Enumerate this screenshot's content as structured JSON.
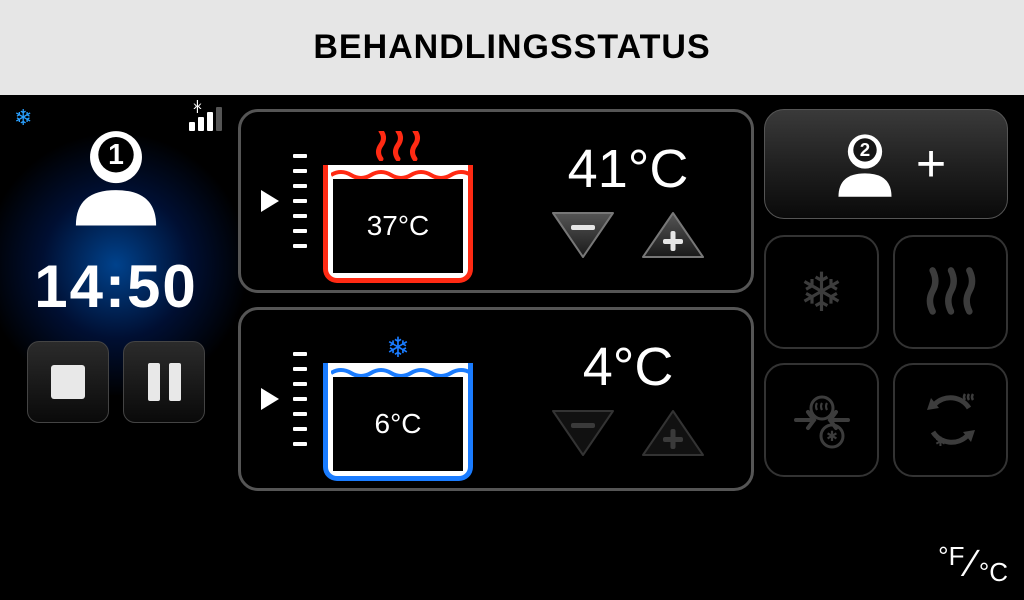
{
  "header": {
    "title": "BEHANDLINGSSTATUS"
  },
  "left": {
    "user_number": "1",
    "timer": "14:50"
  },
  "hot": {
    "tank_temp": "37°C",
    "target_temp": "41°C"
  },
  "cold": {
    "tank_temp": "6°C",
    "target_temp": "4°C"
  },
  "right": {
    "add_user_number": "2"
  },
  "units": {
    "f": "°F",
    "c": "°C"
  }
}
